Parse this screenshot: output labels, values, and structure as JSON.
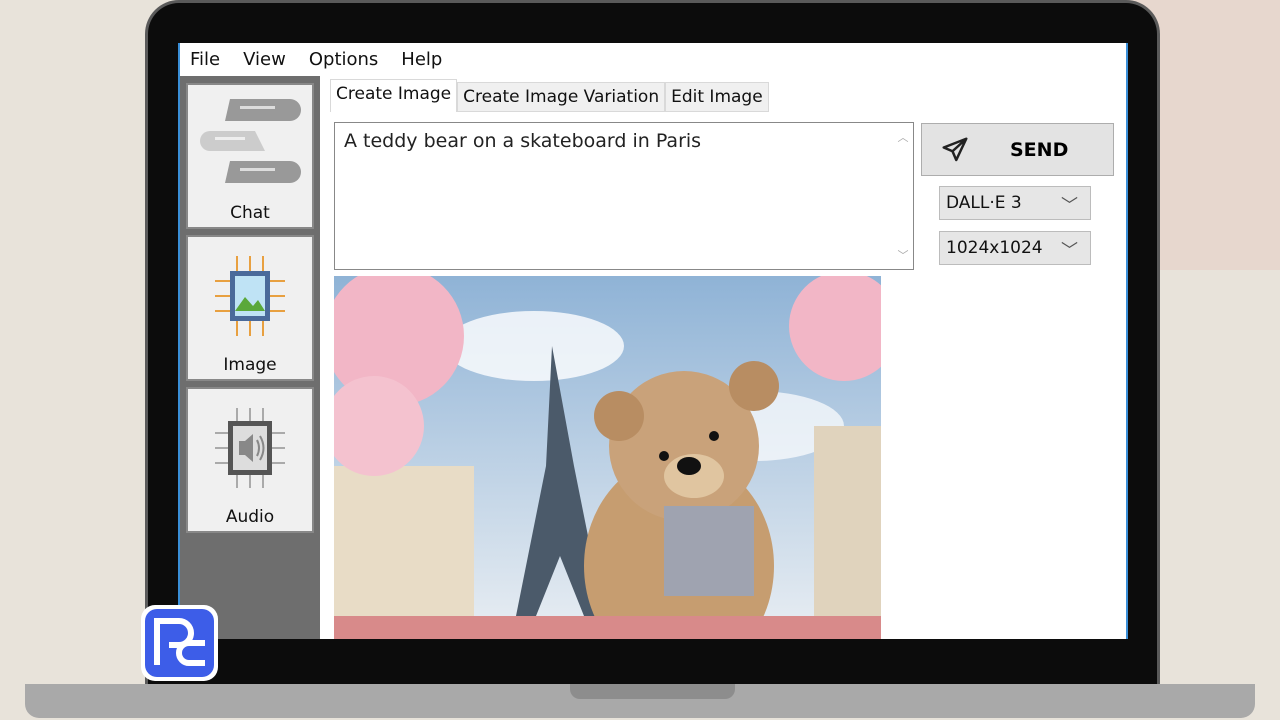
{
  "menu": [
    "File",
    "View",
    "Options",
    "Help"
  ],
  "sidebar": [
    {
      "label": "Chat",
      "icon": "chat-bubbles-icon"
    },
    {
      "label": "Image",
      "icon": "image-chip-icon"
    },
    {
      "label": "Audio",
      "icon": "speaker-chip-icon"
    }
  ],
  "tabs": [
    "Create Image",
    "Create Image Variation",
    "Edit Image"
  ],
  "prompt": "A teddy bear on a skateboard in Paris",
  "send_label": "SEND",
  "model": "DALL·E 3",
  "size": "1024x1024",
  "colors": {
    "accent": "#3a8fd8",
    "sidebar": "#6e6e6e"
  }
}
